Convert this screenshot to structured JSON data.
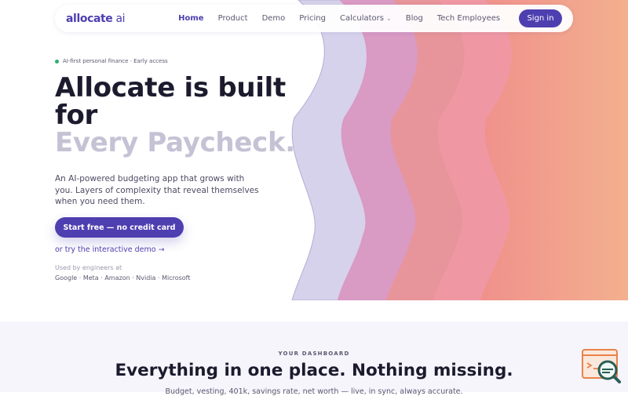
{
  "nav": {
    "logo": "allocate",
    "logo_suffix": " ai",
    "links": [
      "Home",
      "Product",
      "Demo",
      "Pricing",
      "Calculators",
      "Blog",
      "Tech Employees"
    ],
    "signin": "Sign in"
  },
  "hero": {
    "eyebrow": "AI-first personal finance · Early access",
    "title": "Allocate is built for",
    "title_faded": "Every Paycheck.",
    "description": "An AI-powered budgeting app that grows with you. Layers of complexity that reveal themselves when you need them.",
    "cta": "Start free — no credit card",
    "demo_link": "or try the interactive demo →",
    "used_by": "Used by engineers at",
    "companies": "Google · Meta · Amazon · Nvidia · Microsoft"
  },
  "dashboard": {
    "label": "YOUR DASHBOARD",
    "title": "Everything in one place. Nothing missing.",
    "subtitle": "Budget, vesting, 401k, savings rate, net worth — live, in sync, always accurate."
  },
  "colors": {
    "accent": "#4d3fb0",
    "text": "#1c1b2e",
    "faded_title": "#c4c2d4",
    "live_dot": "#2fae6b"
  },
  "icons": {
    "chevron": "chevron-down-icon",
    "badge": "search-analytics-icon"
  }
}
